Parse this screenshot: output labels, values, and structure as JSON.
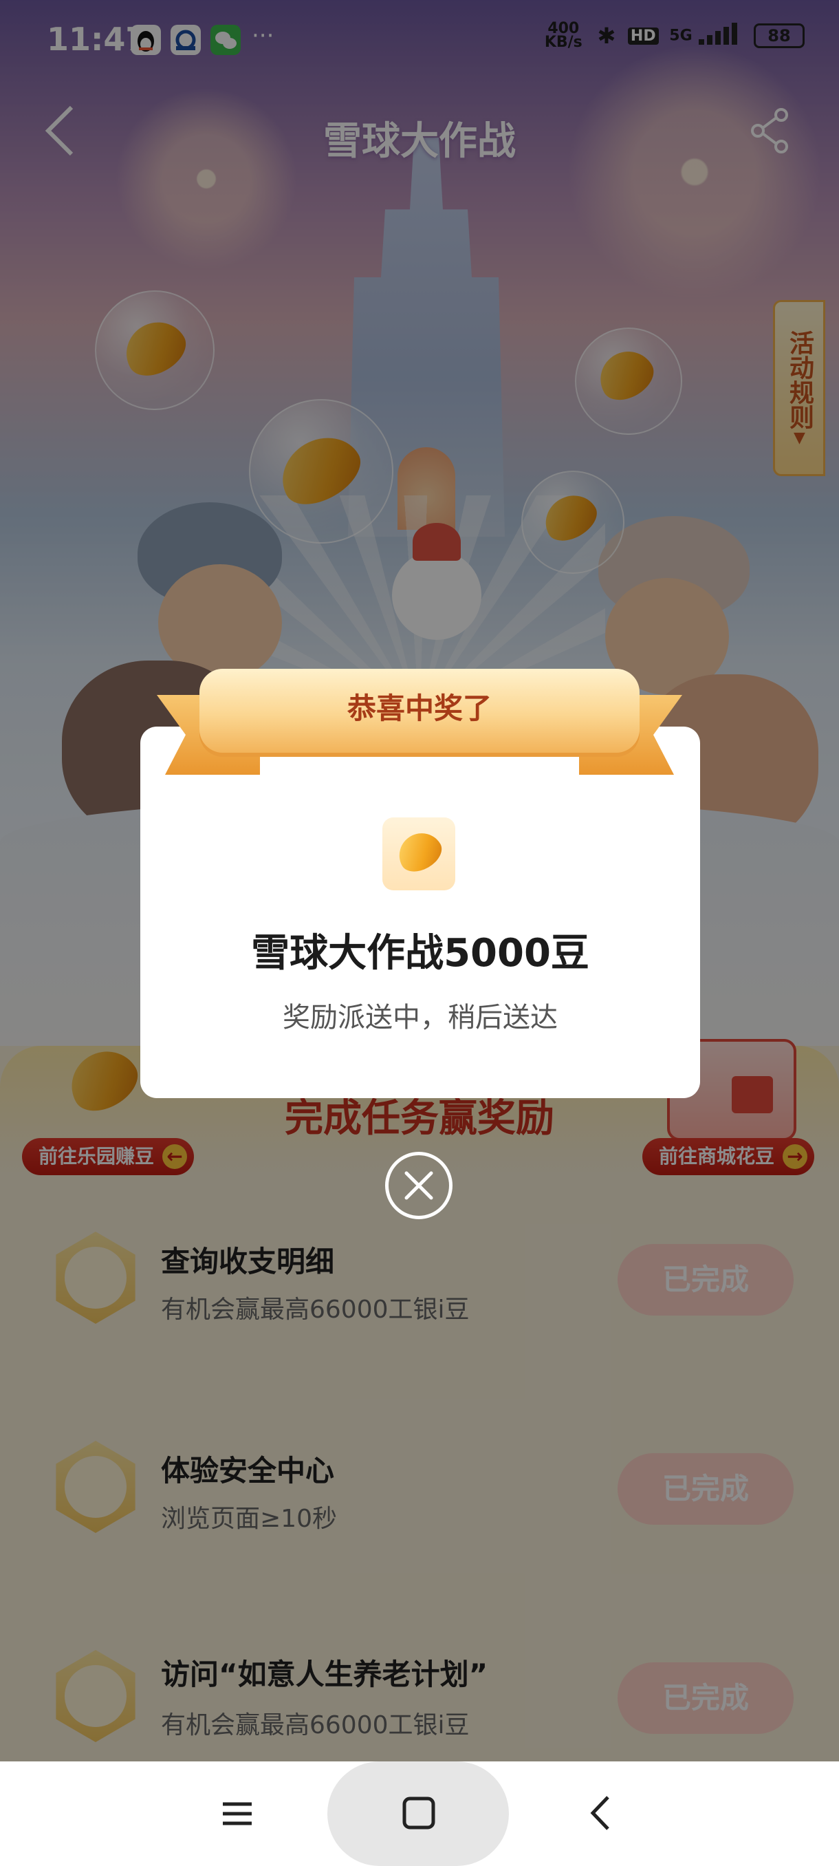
{
  "status_bar": {
    "time": "11:47",
    "apps": [
      "qq-icon",
      "bank-app-icon",
      "wechat-icon"
    ],
    "more": "···",
    "net_speed_value": "400",
    "net_speed_unit": "KB/s",
    "hd": "HD",
    "network": "5G",
    "battery": "88"
  },
  "header": {
    "title": "雪球大作战",
    "back_icon": "chevron-left-icon",
    "share_icon": "share-icon"
  },
  "rules_tab": {
    "label": "活动规则",
    "arrow": "▼"
  },
  "task_section": {
    "title": "完成任务赢奖励",
    "left_link": "前往乐园赚豆",
    "right_link": "前往商城花豆",
    "tasks": [
      {
        "name": "查询收支明细",
        "desc": "有机会赢最高66000工银i豆",
        "status": "已完成",
        "icon": "receipt-icon"
      },
      {
        "name": "体验安全中心",
        "desc": "浏览页面≥10秒",
        "status": "已完成",
        "icon": "clipboard-icon"
      },
      {
        "name": "访问“如意人生养老计划”",
        "desc": "有机会赢最高66000工银i豆",
        "status": "已完成",
        "icon": "magnifier-icon"
      }
    ]
  },
  "modal": {
    "ribbon": "恭喜中奖了",
    "prize_icon": "bean-icon",
    "prize_title": "雪球大作战5000豆",
    "prize_sub": "奖励派送中，稍后送达",
    "close_icon": "close-icon"
  },
  "colors": {
    "accent_red": "#c8321f",
    "ribbon_gold": "#f2b35a",
    "done_button": "#ffd1c7"
  }
}
